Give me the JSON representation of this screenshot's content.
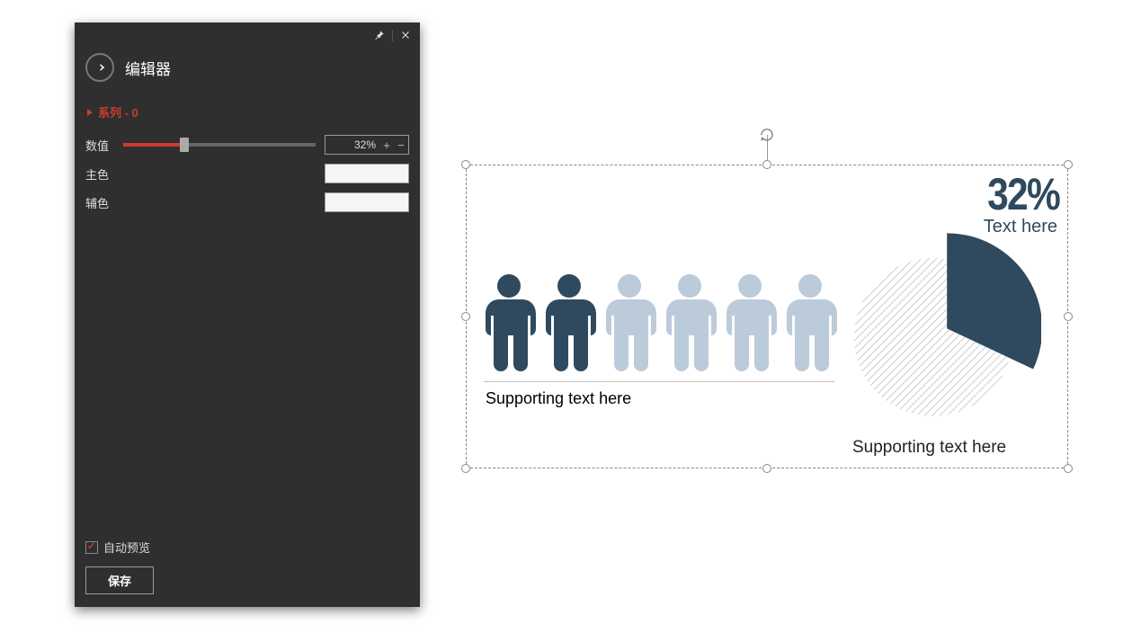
{
  "panel": {
    "title": "编辑器",
    "series_label": "系列 -  0",
    "fields": {
      "value_label": "数值",
      "main_color_label": "主色",
      "accent_color_label": "辅色",
      "spinner_value": "32%"
    },
    "auto_preview_label": "自动预览",
    "save_label": "保存"
  },
  "chart_data": {
    "type": "pie",
    "title": "",
    "percentage": 32,
    "percentage_display": "32%",
    "subtitle": "Text here",
    "people_total": 6,
    "people_filled": 2,
    "support_text_left": "Supporting text here",
    "support_text_right": "Supporting text here",
    "colors": {
      "primary": "#2f4a5e",
      "faded": "#bccbda",
      "main_color_hex": "#f5f5f5",
      "accent_color_hex": "#f5f5f5"
    }
  }
}
